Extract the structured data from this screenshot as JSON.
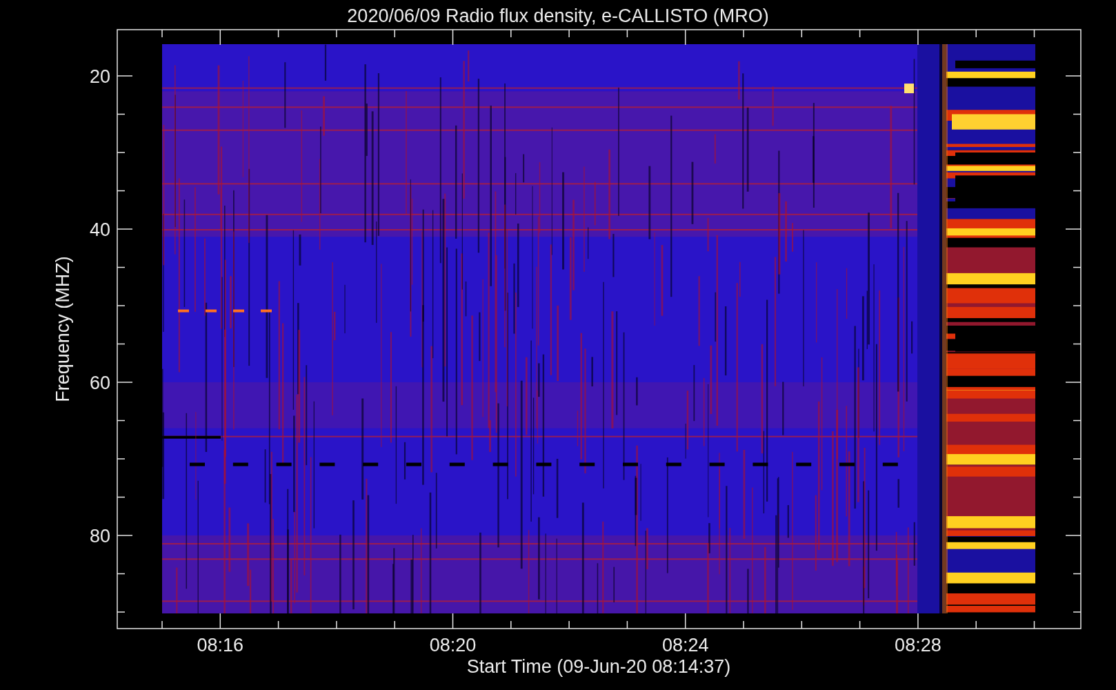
{
  "title": "2020/06/09  Radio flux density, e-CALLISTO (MRO)",
  "y_axis": {
    "label": "Frequency (MHZ)",
    "ticks": [
      "20",
      "40",
      "60",
      "80"
    ]
  },
  "x_axis": {
    "label": "Start Time (09-Jun-20 08:14:37)",
    "ticks": [
      "08:16",
      "08:20",
      "08:24",
      "08:28"
    ]
  }
}
